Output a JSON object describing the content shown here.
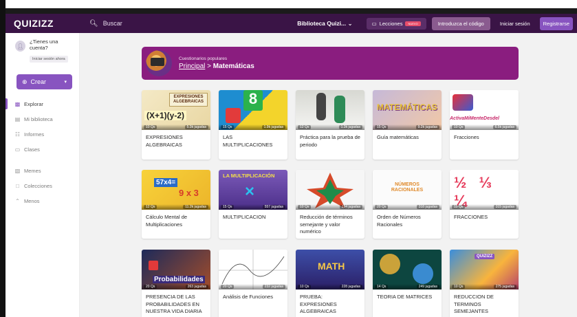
{
  "topnav": {
    "logo": "QUIZIZZ",
    "search_placeholder": "Buscar",
    "library": "Biblioteca Quizi...",
    "lessons": "Lecciones",
    "lessons_badge": "NUEVO",
    "code": "Introduzca el código",
    "login": "Iniciar sesión",
    "signup": "Registrarse"
  },
  "sidebar": {
    "account_q": "¿Tienes una cuenta?",
    "account_btn": "Iniciar sesión ahora",
    "create": "Crear",
    "items": [
      {
        "label": "Explorar",
        "icon": "explore-icon"
      },
      {
        "label": "Mi biblioteca",
        "icon": "library-icon"
      },
      {
        "label": "Informes",
        "icon": "reports-icon"
      },
      {
        "label": "Clases",
        "icon": "classes-icon"
      },
      {
        "label": "Memes",
        "icon": "memes-icon"
      },
      {
        "label": "Colecciones",
        "icon": "collections-icon"
      },
      {
        "label": "Menos",
        "icon": "chevron-up-icon"
      }
    ]
  },
  "banner": {
    "subtitle": "Cuestionarios populares",
    "crumb_link": "Principal",
    "crumb_sep": ">",
    "crumb_current": "Matemáticas"
  },
  "cards": [
    {
      "title": "EXPRESIONES ALGEBRAICAS",
      "qs": "10 Qs",
      "plays": "5.3k jugadas",
      "thumb_text": "EXPRESIONES ALGEBRAICAS"
    },
    {
      "title": "LAS MULTIPLICACIONES",
      "qs": "15 Qs",
      "plays": "1.9k jugadas",
      "thumb_text": "8"
    },
    {
      "title": "Práctica para la prueba de periodo",
      "qs": "12 Qs",
      "plays": "1.3k jugadas",
      "thumb_text": ""
    },
    {
      "title": "Guía matemáticas",
      "qs": "15 Qs",
      "plays": "9.2k jugadas",
      "thumb_text": "MATEMÁTICAS"
    },
    {
      "title": "Fracciones",
      "qs": "10 Qs",
      "plays": "6.5k jugadas",
      "thumb_text": "ActivaMiMenteDesdel"
    },
    {
      "title": "Cálculo Mental de Multiplicaciones",
      "qs": "12 Qs",
      "plays": "11.2k jugadas",
      "thumb_text": "57x4="
    },
    {
      "title": "MULTIPLICACION",
      "qs": "15 Qs",
      "plays": "557 jugadas",
      "thumb_text": "LA MULTIPLICACIÓN"
    },
    {
      "title": "Reducción de términos semejante y valor numérico",
      "qs": "10 Qs",
      "plays": "194 jugadas",
      "thumb_text": ""
    },
    {
      "title": "Orden de Números Racionales",
      "qs": "20 Qs",
      "plays": "318 jugadas",
      "thumb_text": "NÚMEROS RACIONALES"
    },
    {
      "title": "FRACCIONES",
      "qs": "10 Qs",
      "plays": "315 jugadas",
      "thumb_text": "½ ⅓ ¼"
    },
    {
      "title": "PRESENCIA DE LAS PROBABILIDADES EN NUESTRA VIDA DIARIA",
      "qs": "20 Qs",
      "plays": "263 jugadas",
      "thumb_text": "Probabilidades"
    },
    {
      "title": "Análisis de Funciones",
      "qs": "20 Qs",
      "plays": "232 jugadas",
      "thumb_text": ""
    },
    {
      "title": "PRUEBA: EXPRESIONES ALGEBRAICAS",
      "qs": "10 Qs",
      "plays": "228 jugadas",
      "thumb_text": "MATH"
    },
    {
      "title": "TEORIA DE MATRICES",
      "qs": "14 Qs",
      "plays": "249 jugadas",
      "thumb_text": ""
    },
    {
      "title": "REDUCCION DE TERMINOS SEMEJANTES",
      "qs": "10 Qs",
      "plays": "275 jugadas",
      "thumb_text": "QUIZIZZ"
    }
  ],
  "colors": {
    "topnav": "#3a1446",
    "accent": "#8854c0",
    "banner": "#8a1d7f"
  }
}
